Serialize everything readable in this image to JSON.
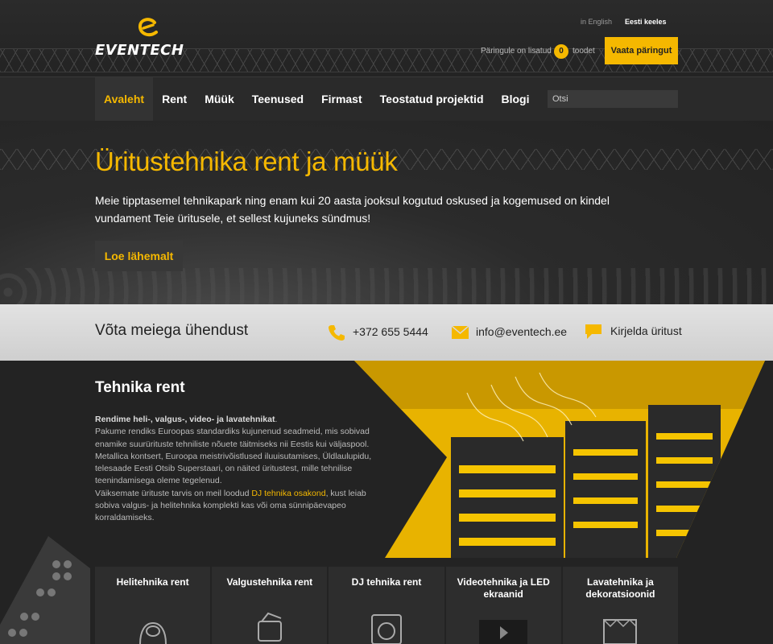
{
  "header": {
    "logo_text": "EVENTECH",
    "lang_en": "in English",
    "lang_et": "Eesti keeles",
    "inquiry_text": "Päringule on lisatud",
    "inquiry_count": "0",
    "inquiry_suffix": "toodet",
    "inquiry_button": "Vaata päringut"
  },
  "nav": {
    "items": [
      "Avaleht",
      "Rent",
      "Müük",
      "Teenused",
      "Firmast",
      "Teostatud projektid",
      "Blogi"
    ],
    "active": "Avaleht",
    "search_placeholder": "Otsi"
  },
  "hero": {
    "title": "Üritustehnika rent ja müük",
    "text": "Meie tipptasemel tehnikapark ning enam kui 20 aasta jooksul kogutud oskused ja kogemused on kindel vundament Teie üritusele, et sellest kujuneks sündmus!",
    "button": "Loe lähemalt"
  },
  "contact": {
    "title": "Võta meiega ühendust",
    "phone": "+372 655 5444",
    "email": "info@eventech.ee",
    "describe": "Kirjelda üritust"
  },
  "rent": {
    "title": "Tehnika rent",
    "lead": "Rendime heli-, valgus-, video- ja lavatehnikat",
    "lead_dot": ".",
    "p1": "Pakume rendiks Euroopas standardiks kujunenud seadmeid, mis sobivad enamike suurürituste tehniliste nõuete täitmiseks nii Eestis kui väljaspool. Metallica kontsert, Euroopa meistrivõistlused iluuisutamises, Üldlaulupidu, telesaade Eesti Otsib Superstaari, on näited üritustest, mille tehnilise teenindamisega oleme tegelenud.",
    "p2_before": "Väiksemate ürituste tarvis on meil loodud ",
    "p2_link": "DJ tehnika osakond",
    "p2_after": ", kust leiab sobiva valgus- ja helitehnika komplekti kas või oma sünnipäevapeo korraldamiseks."
  },
  "cards": [
    {
      "title": "Helitehnika rent",
      "icon": "speaker-icon"
    },
    {
      "title": "Valgustehnika rent",
      "icon": "spotlight-icon"
    },
    {
      "title": "DJ tehnika rent",
      "icon": "turntable-icon"
    },
    {
      "title": "Videotehnika ja LED ekraanid",
      "icon": "video-screen-icon"
    },
    {
      "title": "Lavatehnika ja dekoratsioonid",
      "icon": "stage-truss-icon"
    }
  ],
  "colors": {
    "accent": "#f5b800",
    "dark": "#232323",
    "contact_bar": "#d8d8d8"
  }
}
